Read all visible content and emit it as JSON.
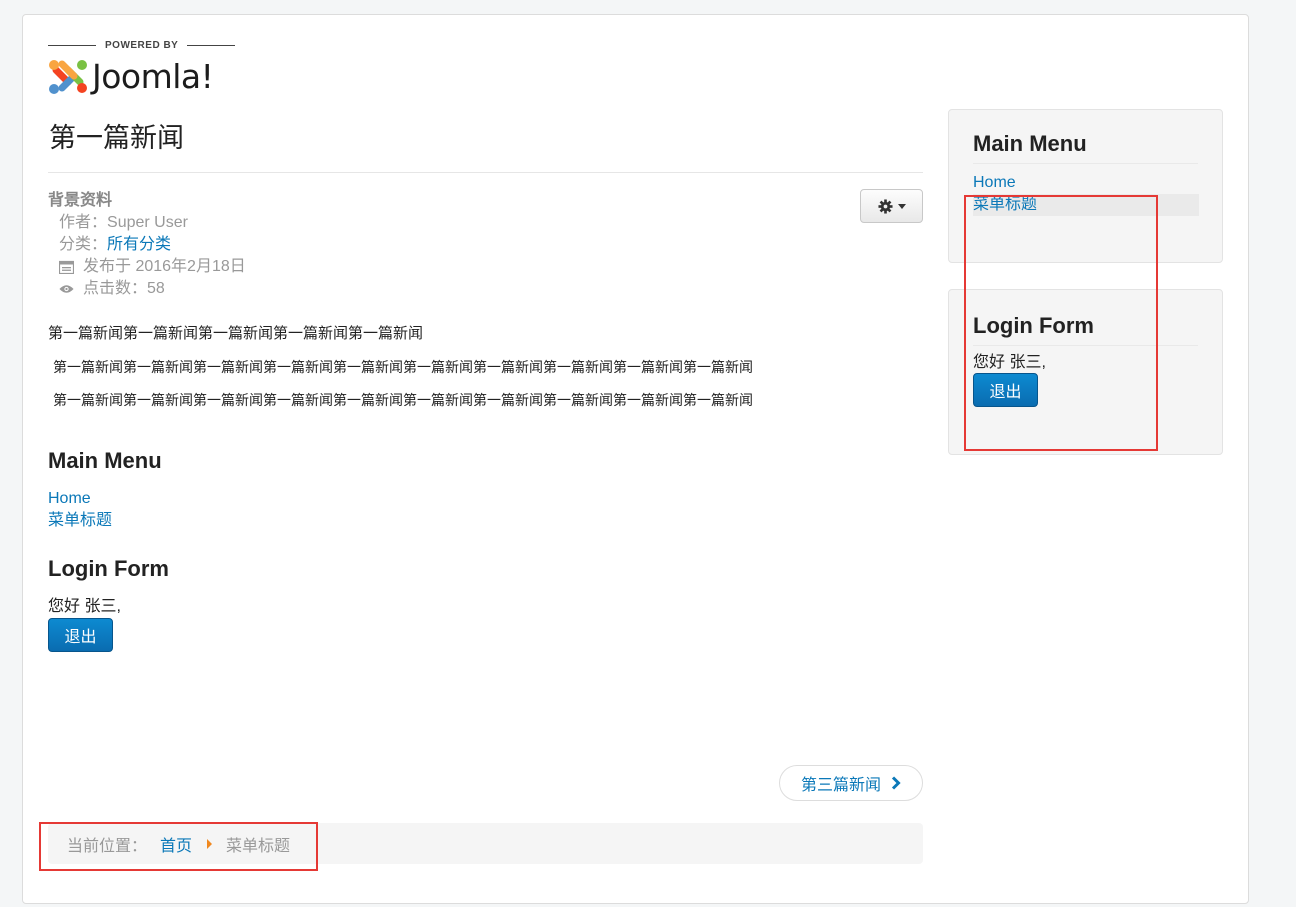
{
  "logo": {
    "powered_by": "POWERED BY",
    "wordmark": "Joomla!"
  },
  "article": {
    "title": "第一篇新闻",
    "info_title": "背景资料",
    "author_label": "作者：",
    "author": "Super User",
    "category_label": "分类：",
    "category": "所有分类",
    "published": "发布于 2016年2月18日",
    "hits": "点击数：58",
    "paragraphs": [
      "第一篇新闻第一篇新闻第一篇新闻第一篇新闻第一篇新闻",
      "第一篇新闻第一篇新闻第一篇新闻第一篇新闻第一篇新闻第一篇新闻第一篇新闻第一篇新闻第一篇新闻第一篇新闻",
      "第一篇新闻第一篇新闻第一篇新闻第一篇新闻第一篇新闻第一篇新闻第一篇新闻第一篇新闻第一篇新闻第一篇新闻"
    ]
  },
  "main_menu": {
    "title": "Main Menu",
    "items": [
      "Home",
      "菜单标题"
    ]
  },
  "login_form": {
    "title": "Login Form",
    "greeting": "您好 张三,",
    "logout": "退出"
  },
  "pager": {
    "next_label": "第三篇新闻"
  },
  "breadcrumb": {
    "label": "当前位置：",
    "home": "首页",
    "current": "菜单标题"
  },
  "sidebar": {
    "main_menu": {
      "title": "Main Menu",
      "items": [
        "Home",
        "菜单标题"
      ]
    },
    "login_form": {
      "title": "Login Form",
      "greeting": "您好 张三,",
      "logout": "退出"
    }
  },
  "colors": {
    "link": "#0b78b8",
    "primary_button": "#0a7dc4",
    "highlight_box": "#e53935",
    "breadcrumb_separator": "#f0881f"
  }
}
